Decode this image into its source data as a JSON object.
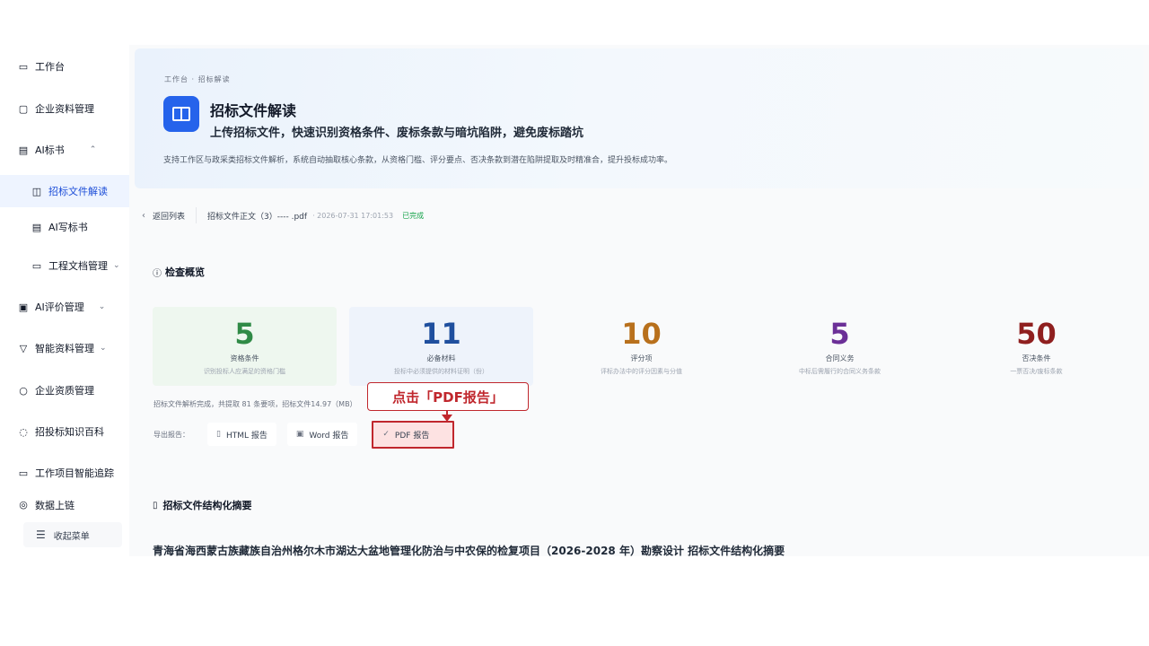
{
  "sidebar": {
    "items": [
      {
        "label": "工作台",
        "icon": "monitor-icon",
        "glyph": "▭"
      },
      {
        "label": "企业资料管理",
        "icon": "briefcase-icon",
        "glyph": "▢"
      },
      {
        "label": "AI标书",
        "icon": "document-icon",
        "glyph": "▤",
        "chevron": "⌃"
      },
      {
        "label": "招标文件解读",
        "icon": "book-icon",
        "glyph": "◫"
      },
      {
        "label": "AI写标书",
        "icon": "file-icon",
        "glyph": "▤"
      },
      {
        "label": "工程文档管理",
        "icon": "folder-icon",
        "glyph": "▭",
        "chevron": "⌄"
      },
      {
        "label": "AI评价管理",
        "icon": "chart-icon",
        "glyph": "▣",
        "chevron": "⌄"
      },
      {
        "label": "智能资料管理",
        "icon": "filter-icon",
        "glyph": "▽",
        "chevron": "⌄"
      },
      {
        "label": "企业资质管理",
        "icon": "search-icon",
        "glyph": "○"
      },
      {
        "label": "招投标知识百科",
        "icon": "chat-icon",
        "glyph": "◌"
      },
      {
        "label": "工作项目智能追踪",
        "icon": "video-icon",
        "glyph": "▭"
      },
      {
        "label": "数据上链",
        "icon": "gear-icon",
        "glyph": "◎"
      }
    ],
    "collapse_label": "收起菜单",
    "collapse_icon": "menu-icon"
  },
  "hero": {
    "breadcrumb": "工作台 · 招标解读",
    "title": "招标文件解读",
    "subtitle": "上传招标文件，快速识别资格条件、废标条款与暗坑陷阱，避免废标踏坑",
    "description": "支持工作区与政采类招标文件解析，系统自动抽取核心条款，从资格门槛、评分要点、否决条款到潜在陷阱提取及时精准合，提升投标成功率。"
  },
  "toolbar": {
    "back_label": "返回列表",
    "file_name": "招标文件正文（3）---- .pdf",
    "file_time": "· 2026-07-31 17:01:53",
    "status": "已完成"
  },
  "overview": {
    "title": "检查概览",
    "stats": [
      {
        "value": "5",
        "label": "资格条件",
        "desc": "识别投标人应满足的资格门槛",
        "color": "#2f8a46",
        "bg": "#eef7ef"
      },
      {
        "value": "11",
        "label": "必备材料",
        "desc": "投标中必须提供的材料证明（份）",
        "color": "#1f4f9e",
        "bg": "#eef3fb"
      },
      {
        "value": "10",
        "label": "评分项",
        "desc": "评标办法中的评分因素与分值",
        "color": "#b8701c",
        "bg": "#f9fafb"
      },
      {
        "value": "5",
        "label": "合同义务",
        "desc": "中标后需履行的合同义务条款",
        "color": "#6b2f97",
        "bg": "#f9fafb"
      },
      {
        "value": "50",
        "label": "否决条件",
        "desc": "一票否决/废标条款",
        "color": "#8f1f1f",
        "bg": "#f9fafb"
      }
    ],
    "footnote": "招标文件解析完成，共提取 81 条要项，招标文件14.97（MB）",
    "export_label": "导出报告：",
    "exports": [
      {
        "label": "HTML 报告",
        "icon": "file-icon",
        "glyph": "▯"
      },
      {
        "label": "Word 报告",
        "icon": "word-icon",
        "glyph": "▣"
      },
      {
        "label": "PDF 报告",
        "icon": "pdf-icon",
        "glyph": "✓"
      }
    ]
  },
  "callout": {
    "text": "点击「PDF报告」",
    "color": "#c0272d"
  },
  "summary": {
    "title": "招标文件结构化摘要",
    "doc_title": "青海省海西蒙古族藏族自治州格尔木市湖达大盆地管理化防治与中农保的检复项目（2026-2028 年）勘察设计 招标文件结构化摘要"
  }
}
